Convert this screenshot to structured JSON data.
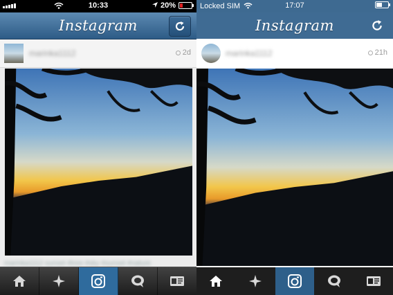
{
  "left": {
    "status": {
      "time": "10:33",
      "battery": "20%"
    },
    "navbar": {
      "title": "Instagram"
    },
    "post": {
      "username": "marinka1112",
      "age": "2d",
      "caption": "marinka1112 sunset #tree #sky #sunset #nature"
    },
    "tabs": [
      {
        "name": "home",
        "active": false
      },
      {
        "name": "explore",
        "active": false
      },
      {
        "name": "camera",
        "active": true
      },
      {
        "name": "news",
        "active": false
      },
      {
        "name": "profile",
        "active": false
      }
    ]
  },
  "right": {
    "status": {
      "carrier": "Locked SIM",
      "time": "17:07"
    },
    "navbar": {
      "title": "Instagram"
    },
    "post": {
      "username": "marinka1112",
      "age": "21h"
    },
    "tabs": [
      {
        "name": "home",
        "active": false
      },
      {
        "name": "explore",
        "active": false
      },
      {
        "name": "camera",
        "active": true
      },
      {
        "name": "news",
        "active": false
      },
      {
        "name": "profile",
        "active": false
      }
    ]
  },
  "colors": {
    "navbar_blue": "#3f6b93",
    "active_tab": "#2f6b9d",
    "battery_low": "#e02020"
  }
}
